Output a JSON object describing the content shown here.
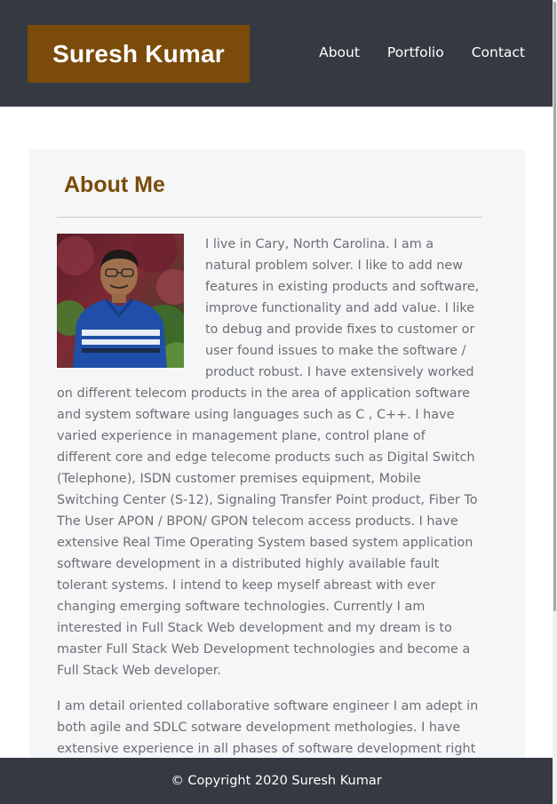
{
  "header": {
    "brand": "Suresh Kumar",
    "nav": [
      "About",
      "Portfolio",
      "Contact"
    ]
  },
  "about": {
    "title": "About Me",
    "paragraphs": [
      "I live in Cary, North Carolina. I am a natural problem solver. I like to add new features in existing products and software, improve functionality and add value. I like to debug and provide fixes to customer or user found issues to make the software / product robust. I have extensively worked on different telecom products in the area of application software and system software using languages such as C , C++. I have varied experience in management plane, control plane of different core and edge telecome products such as Digital Switch (Telephone), ISDN customer premises equipment, Mobile Switching Center (S-12), Signaling Transfer Point product, Fiber To The User APON / BPON/ GPON telecom access products. I have extensive Real Time Operating System based system application software development in a distributed highly available fault tolerant systems. I intend to keep myself abreast with ever changing emerging software technologies. Currently I am interested in Full Stack Web development and my dream is to master Full Stack Web Development technologies and become a Full Stack Web developer.",
      "I am detail oriented collaborative software engineer I am adept in both agile and SDLC sotware development methologies. I have extensive experience in all phases of software development right"
    ]
  },
  "footer": {
    "copyright": "© Copyright 2020 Suresh Kumar"
  },
  "colors": {
    "header_bg": "#353a42",
    "brand_bg": "#7a4b0a",
    "title_color": "#7a4b0a",
    "card_bg": "#f5f6f7",
    "body_text": "#6c6f73"
  }
}
